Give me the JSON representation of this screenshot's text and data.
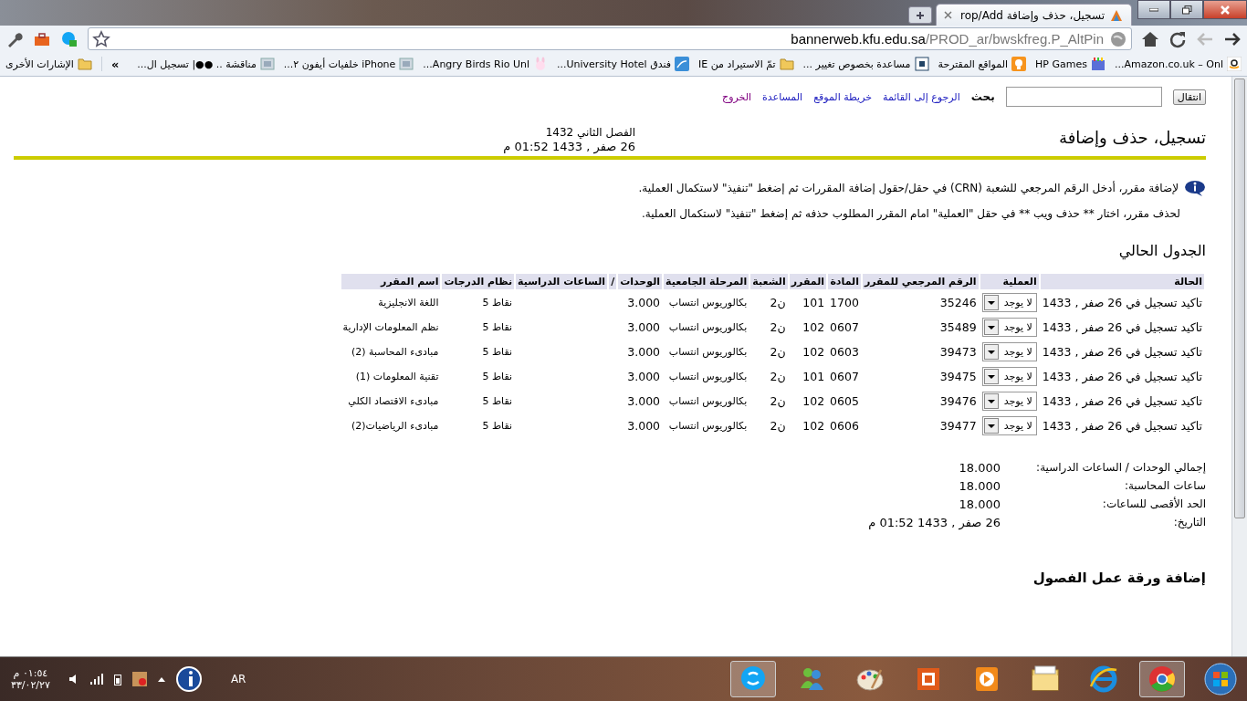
{
  "browser": {
    "tab_title": "تسجيل، حذف وإضافة rop/Add",
    "url_host": "bannerweb.kfu.edu.sa",
    "url_path": "/PROD_ar/bwskfreg.P_AltPin",
    "bookmarks": [
      {
        "label": "Amazon.co.uk – Onl...",
        "kind": "amazon"
      },
      {
        "label": "HP Games",
        "kind": "games"
      },
      {
        "label": "المواقع المقترحة",
        "kind": "bulb"
      },
      {
        "label": "مساعدة بخصوص تغيير ...",
        "kind": "help"
      },
      {
        "label": "تمّ الاستيراد من IE",
        "kind": "folder"
      },
      {
        "label": "فندق University Hotel...",
        "kind": "globe"
      },
      {
        "label": "Angry Birds Rio Unl...",
        "kind": "bunny"
      },
      {
        "label": "iPhone خلفيات أيفون ٢...",
        "kind": "page"
      },
      {
        "label": "مناقشة .. ●●| تسجيل ال...",
        "kind": "page"
      }
    ],
    "overflow_chevron": "»",
    "other_bookmarks": "الإشارات الأخرى"
  },
  "page": {
    "nav_links": [
      "الرجوع إلى القائمة",
      "خريطة الموقع",
      "المساعدة",
      "الخروج"
    ],
    "search_label": "بحث",
    "go_button": "انتقال",
    "title": "تسجيل، حذف وإضافة",
    "term": "الفصل الثاني 1432",
    "timestamp": "26 صفر , 1433 01:52 م",
    "info_lines": [
      "لإضافة مقرر، أدخل الرقم المرجعي للشعبة (CRN) في حقل/حقول إضافة المقررات ثم إضغط \"تنفيذ\" لاستكمال العملية.",
      "لحذف مقرر، اختار ** حذف ويب ** في حقل \"العملية\" امام المقرر المطلوب حذفه ثم إضغط \"تنفيذ\" لاستكمال العملية."
    ],
    "section_title": "الجدول الحالي",
    "table": {
      "columns": [
        "الحالة",
        "العملية",
        "الرقم المرجعي للمقرر",
        "المادة",
        "المقرر",
        "الشعبة",
        "المرحلة الجامعية",
        "الوحدات",
        "/",
        "الساعات الدراسية",
        "نظام الدرجات",
        "اسم المقرر"
      ],
      "rows": [
        {
          "status": "تاكيد تسجيل في 26 صفر , 1433",
          "action": "لا يوجد",
          "crn": "35246",
          "subject": "1700",
          "course": "101",
          "section": "ن2",
          "level": "بكالوريوس انتساب",
          "units": "3.000",
          "grading": "نقاط 5",
          "title": "اللغة الانجليزية"
        },
        {
          "status": "تاكيد تسجيل في 26 صفر , 1433",
          "action": "لا يوجد",
          "crn": "35489",
          "subject": "0607",
          "course": "102",
          "section": "ن2",
          "level": "بكالوريوس انتساب",
          "units": "3.000",
          "grading": "نقاط 5",
          "title": "نظم المعلومات الإدارية"
        },
        {
          "status": "تاكيد تسجيل في 26 صفر , 1433",
          "action": "لا يوجد",
          "crn": "39473",
          "subject": "0603",
          "course": "102",
          "section": "ن2",
          "level": "بكالوريوس انتساب",
          "units": "3.000",
          "grading": "نقاط 5",
          "title": "مبادىء المحاسبة (2)"
        },
        {
          "status": "تاكيد تسجيل في 26 صفر , 1433",
          "action": "لا يوجد",
          "crn": "39475",
          "subject": "0607",
          "course": "101",
          "section": "ن2",
          "level": "بكالوريوس انتساب",
          "units": "3.000",
          "grading": "نقاط 5",
          "title": "تقنية المعلومات (1)"
        },
        {
          "status": "تاكيد تسجيل في 26 صفر , 1433",
          "action": "لا يوجد",
          "crn": "39476",
          "subject": "0605",
          "course": "102",
          "section": "ن2",
          "level": "بكالوريوس انتساب",
          "units": "3.000",
          "grading": "نقاط 5",
          "title": "مبادىء الاقتصاد الكلي"
        },
        {
          "status": "تاكيد تسجيل في 26 صفر , 1433",
          "action": "لا يوجد",
          "crn": "39477",
          "subject": "0606",
          "course": "102",
          "section": "ن2",
          "level": "بكالوريوس انتساب",
          "units": "3.000",
          "grading": "نقاط 5",
          "title": "مبادىء الرياضيات(2)"
        }
      ]
    },
    "totals": [
      {
        "label": "إجمالي الوحدات / الساعات الدراسية:",
        "value": "18.000"
      },
      {
        "label": "ساعات المحاسبة:",
        "value": "18.000"
      },
      {
        "label": "الحد الأقصى للساعات:",
        "value": "18.000"
      },
      {
        "label": "التاريخ:",
        "value": "26 صفر , 1433 01:52 م"
      }
    ],
    "next_section": "إضافة ورقة عمل الفصول"
  },
  "taskbar": {
    "apps": [
      {
        "kind": "start",
        "active": false
      },
      {
        "kind": "chrome",
        "active": true
      },
      {
        "kind": "ie",
        "active": false
      },
      {
        "kind": "explorer",
        "active": false
      },
      {
        "kind": "media",
        "active": false
      },
      {
        "kind": "office",
        "active": false
      },
      {
        "kind": "paint",
        "active": false
      },
      {
        "kind": "messenger",
        "active": false
      },
      {
        "kind": "skype",
        "active": true
      }
    ],
    "language": "AR",
    "time": "٠١:٥٤ م",
    "date": "٣٣/٠٢/٢٧"
  }
}
